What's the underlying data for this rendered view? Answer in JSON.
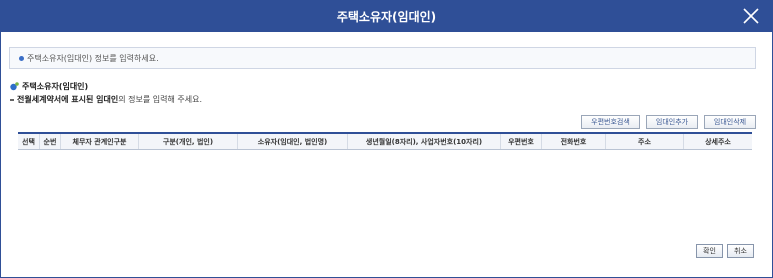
{
  "dialog": {
    "title": "주택소유자(임대인)",
    "close_icon": "close-icon"
  },
  "notice": {
    "text": "주택소유자(임대인) 정보를 입력하세요.",
    "icon": "bullet-dot-icon"
  },
  "section": {
    "title": "주택소유자(임대인)",
    "icon": "section-marker-icon",
    "desc_prefix": "전월세계약서에 표시된 임대인",
    "desc_suffix": "의 정보를 입력해 주세요."
  },
  "toolbar": {
    "search_label": "우편번호검색",
    "add_label": "임대인추가",
    "delete_label": "임대인삭제"
  },
  "table": {
    "columns": [
      "선택",
      "순번",
      "체무자 관계인구분",
      "구분(개인, 법인)",
      "소유자(임대인, 법인명)",
      "생년월일(8자리), 사업자번호(10자리)",
      "우편번호",
      "전화번호",
      "주소",
      "상세주소"
    ],
    "rows": []
  },
  "footer": {
    "confirm_label": "확인",
    "cancel_label": "취소"
  },
  "colors": {
    "primary": "#2f4f97",
    "link": "#3d5a94"
  }
}
